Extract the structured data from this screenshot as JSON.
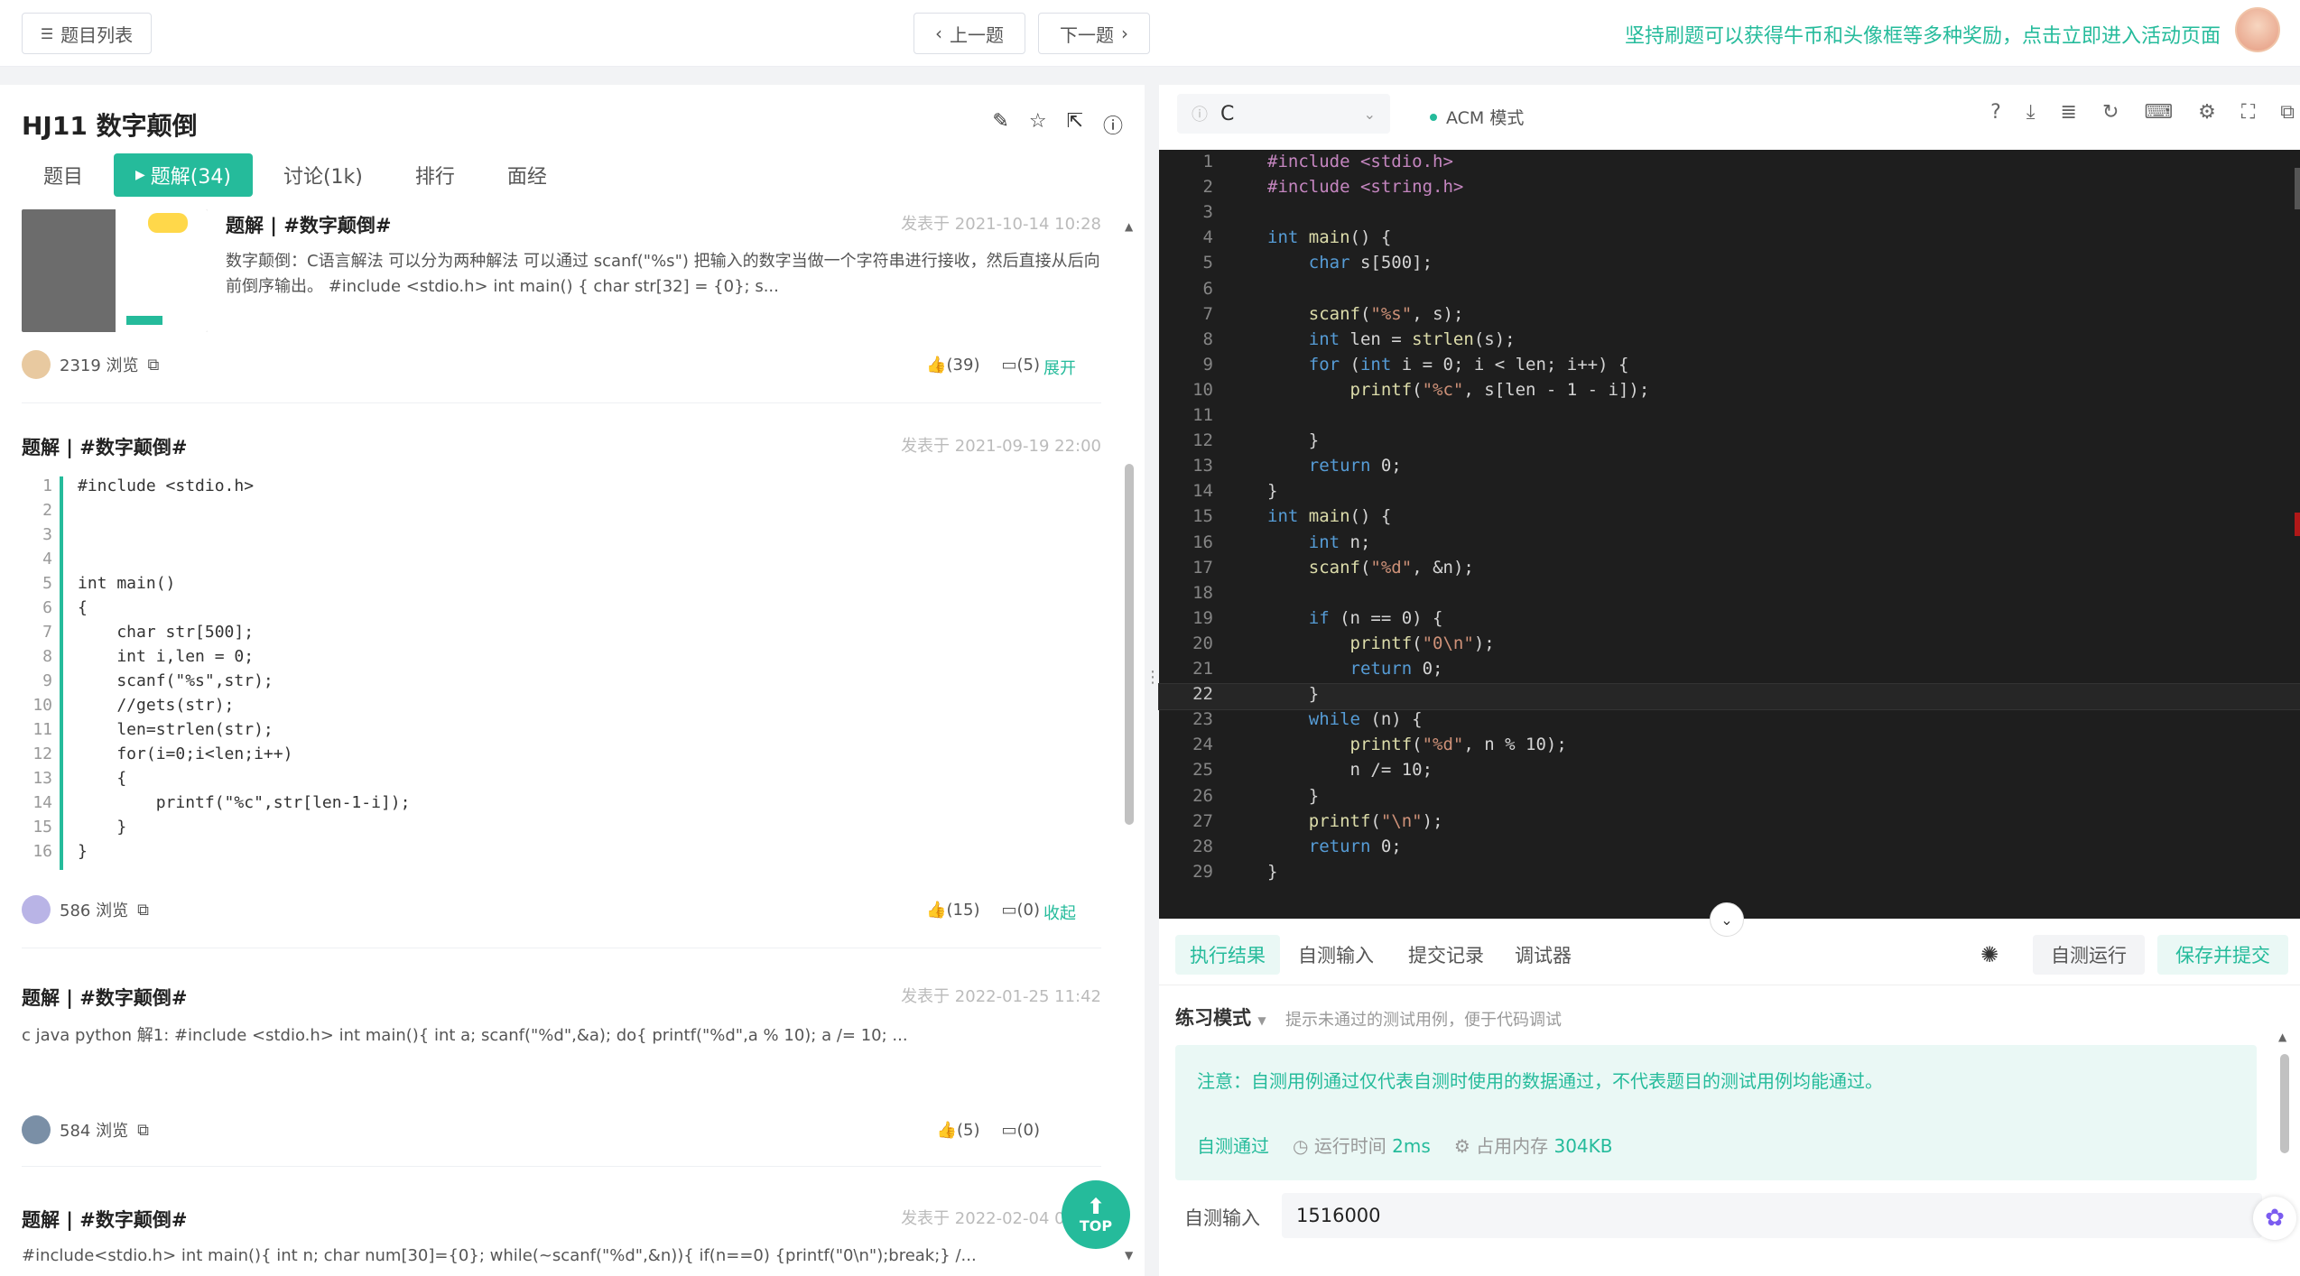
{
  "topbar": {
    "list_label": "题目列表",
    "prev_label": "上一题",
    "next_label": "下一题",
    "promo": "坚持刷题可以获得牛币和头像框等多种奖励，点击立即进入活动页面"
  },
  "problem": {
    "title": "HJ11  数字颠倒",
    "tabs": [
      "题目",
      "题解(34)",
      "讨论(1k)",
      "排行",
      "面经"
    ]
  },
  "posts": [
    {
      "title": "题解 | #数字颠倒#",
      "date": "发表于 2021-10-14 10:28",
      "summary": "数字颠倒：C语言解法 可以分为两种解法 可以通过 scanf(\"%s\") 把输入的数字当做一个字符串进行接收，然后直接从后向前倒序输出。 #include <stdio.h> int main() { char str[32] = {0}; s...",
      "views": "2319 浏览",
      "likes": "(39)",
      "comments": "(5)",
      "action": "展开"
    },
    {
      "title": "题解 | #数字颠倒#",
      "date": "发表于 2021-09-19 22:00",
      "code_lines": [
        "#include <stdio.h>",
        "",
        "",
        "",
        "int main()",
        "{",
        "    char str[500];",
        "    int i,len = 0;",
        "    scanf(\"%s\",str);",
        "    //gets(str);",
        "    len=strlen(str);",
        "    for(i=0;i<len;i++)",
        "    {",
        "        printf(\"%c\",str[len-1-i]);",
        "    }",
        "}"
      ],
      "views": "586 浏览",
      "likes": "(15)",
      "comments": "(0)",
      "action": "收起"
    },
    {
      "title": "题解 | #数字颠倒#",
      "date": "发表于 2022-01-25 11:42",
      "summary": "c java python 解1:   #include <stdio.h> int main(){ int a; scanf(\"%d\",&a); do{ printf(\"%d\",a % 10); a /= 10; ...",
      "views": "584 浏览",
      "likes": "(5)",
      "comments": "(0)"
    },
    {
      "title": "题解 | #数字颠倒#",
      "date": "发表于 2022-02-04 09:41",
      "summary": "#include<stdio.h> int main(){ int n; char num[30]={0}; while(~scanf(\"%d\",&n)){ if(n==0) {printf(\"0\\n\");break;} /..."
    }
  ],
  "top_label": "TOP",
  "editor": {
    "language": "C",
    "mode": "ACM 模式",
    "current_line": 22,
    "lines": [
      "#include <stdio.h>",
      "#include <string.h>",
      "",
      "int main() {",
      "    char s[500];",
      "",
      "    scanf(\"%s\", s);",
      "    int len = strlen(s);",
      "    for (int i = 0; i < len; i++) {",
      "        printf(\"%c\", s[len - 1 - i]);",
      "",
      "    }",
      "    return 0;",
      "}",
      "int main() {",
      "    int n;",
      "    scanf(\"%d\", &n);",
      "",
      "    if (n == 0) {",
      "        printf(\"0\\n\");",
      "        return 0;",
      "    }",
      "    while (n) {",
      "        printf(\"%d\", n % 10);",
      "        n /= 10;",
      "    }",
      "    printf(\"\\n\");",
      "    return 0;",
      "}"
    ]
  },
  "bottom": {
    "tabs": [
      "执行结果",
      "自测输入",
      "提交记录",
      "调试器"
    ],
    "self_run": "自测运行",
    "save_submit": "保存并提交",
    "practice_mode": "练习模式",
    "practice_hint": "提示未通过的测试用例，便于代码调试",
    "note": "注意：自测用例通过仅代表自测时使用的数据通过，不代表题目的测试用例均能通过。",
    "pass": "自测通过",
    "runtime_label": "运行时间",
    "runtime": "2ms",
    "memory_label": "占用内存",
    "memory": "304KB",
    "selfin_label": "自测输入",
    "selfin_value": "1516000"
  },
  "colors": {
    "accent": "#25bb9b",
    "editor_bg": "#1e1e1e"
  }
}
